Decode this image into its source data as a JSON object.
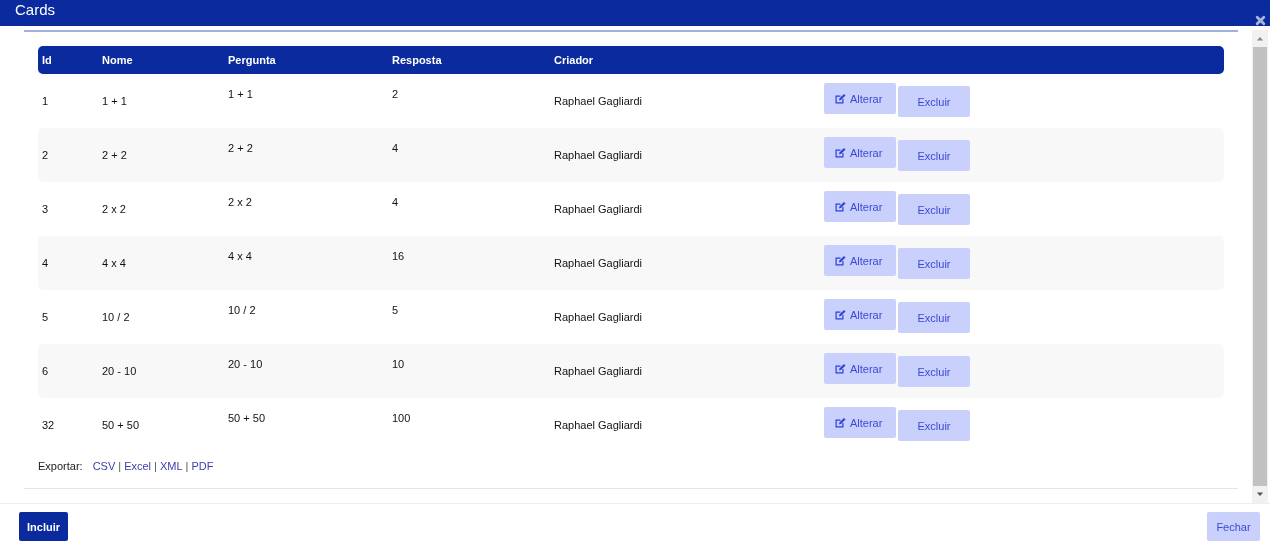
{
  "window": {
    "title": "Cards"
  },
  "table": {
    "columns": [
      "Id",
      "Nome",
      "Pergunta",
      "Resposta",
      "Criador"
    ],
    "rows": [
      {
        "id": "1",
        "nome": "1 + 1",
        "pergunta": "1 + 1",
        "resposta": "2",
        "criador": "Raphael Gagliardi",
        "edit": "Alterar",
        "delete": "Excluir"
      },
      {
        "id": "2",
        "nome": "2 + 2",
        "pergunta": "2 + 2",
        "resposta": "4",
        "criador": "Raphael Gagliardi",
        "edit": "Alterar",
        "delete": "Excluir"
      },
      {
        "id": "3",
        "nome": "2 x 2",
        "pergunta": "2 x 2",
        "resposta": "4",
        "criador": "Raphael Gagliardi",
        "edit": "Alterar",
        "delete": "Excluir"
      },
      {
        "id": "4",
        "nome": "4 x 4",
        "pergunta": "4 x 4",
        "resposta": "16",
        "criador": "Raphael Gagliardi",
        "edit": "Alterar",
        "delete": "Excluir"
      },
      {
        "id": "5",
        "nome": "10 / 2",
        "pergunta": "10 / 2",
        "resposta": "5",
        "criador": "Raphael Gagliardi",
        "edit": "Alterar",
        "delete": "Excluir"
      },
      {
        "id": "6",
        "nome": "20 - 10",
        "pergunta": "20 - 10",
        "resposta": "10",
        "criador": "Raphael Gagliardi",
        "edit": "Alterar",
        "delete": "Excluir"
      },
      {
        "id": "32",
        "nome": "50 + 50",
        "pergunta": "50 + 50",
        "resposta": "100",
        "criador": "Raphael Gagliardi",
        "edit": "Alterar",
        "delete": "Excluir"
      }
    ]
  },
  "export": {
    "label": "Exportar:",
    "links": [
      "CSV",
      "Excel",
      "XML",
      "PDF"
    ],
    "separator": "|"
  },
  "footer": {
    "primary": "Incluir",
    "secondary": "Fechar"
  }
}
